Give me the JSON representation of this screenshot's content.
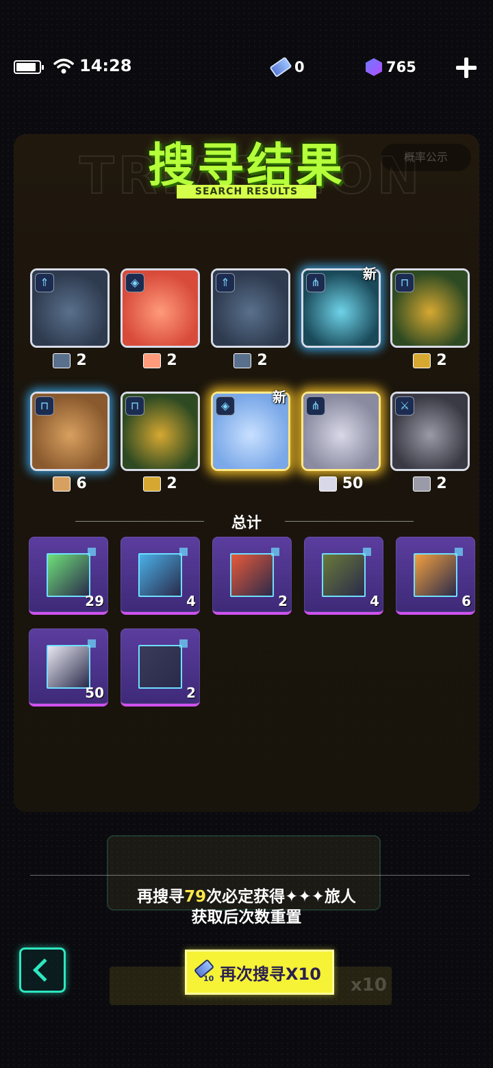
{
  "status_bar": {
    "time": "14:28",
    "ticket_count": "0",
    "gem_count": "765"
  },
  "header": {
    "title": "搜寻结果",
    "subtitle": "SEARCH RESULTS"
  },
  "results": [
    {
      "badge": "⇑",
      "count": "2",
      "new": "",
      "glow": "none",
      "colors": [
        "#2e3a4e",
        "#59708c"
      ]
    },
    {
      "badge": "◈",
      "count": "2",
      "new": "",
      "glow": "none",
      "colors": [
        "#d84a3a",
        "#ff9a7a"
      ]
    },
    {
      "badge": "⇑",
      "count": "2",
      "new": "",
      "glow": "none",
      "colors": [
        "#2e3a4e",
        "#59708c"
      ]
    },
    {
      "badge": "⋔",
      "count": "",
      "new": "新",
      "glow": "blue",
      "colors": [
        "#1a4a5a",
        "#6fd3e8"
      ]
    },
    {
      "badge": "⊓",
      "count": "2",
      "new": "",
      "glow": "none",
      "colors": [
        "#2e4a22",
        "#d6a832"
      ]
    },
    {
      "badge": "⊓",
      "count": "6",
      "new": "",
      "glow": "blue",
      "colors": [
        "#8a5a2e",
        "#d8a060"
      ]
    },
    {
      "badge": "⊓",
      "count": "2",
      "new": "",
      "glow": "none",
      "colors": [
        "#2e4a22",
        "#d6a832"
      ]
    },
    {
      "badge": "◈",
      "count": "",
      "new": "新",
      "glow": "gold",
      "colors": [
        "#7aa8e8",
        "#c8e0ff"
      ]
    },
    {
      "badge": "⋔",
      "count": "50",
      "new": "",
      "glow": "gold",
      "colors": [
        "#8a8aa0",
        "#d8d8e8"
      ]
    },
    {
      "badge": "⚔",
      "count": "2",
      "new": "",
      "glow": "none",
      "colors": [
        "#3a3a44",
        "#9a9aa8"
      ]
    }
  ],
  "total": {
    "label": "总计",
    "items": [
      {
        "qty": "29",
        "color": "#6fe07a"
      },
      {
        "qty": "4",
        "color": "#4ab0e8"
      },
      {
        "qty": "2",
        "color": "#e85a3a"
      },
      {
        "qty": "4",
        "color": "#6a7a3a"
      },
      {
        "qty": "6",
        "color": "#f2a040"
      },
      {
        "qty": "50",
        "color": "#e8e8f2"
      },
      {
        "qty": "2",
        "color": "#3a3a5a"
      }
    ]
  },
  "notice": {
    "line1_prefix": "再搜寻",
    "line1_number": "79",
    "line1_suffix": "次必定获得✦✦✦旅人",
    "line2": "获取后次数重置"
  },
  "actions": {
    "search_again_label": "再次搜寻X10",
    "ticket_ten": "10"
  },
  "colors": {
    "accent_green": "#b6ff3b",
    "accent_teal": "#2de8c0",
    "button_yellow": "#f6f236",
    "tile_purple": "#5b3d9e"
  }
}
